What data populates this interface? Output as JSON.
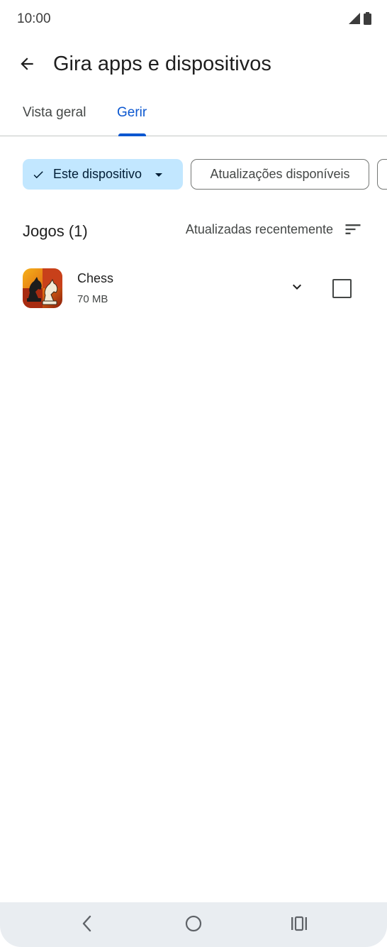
{
  "status_bar": {
    "time": "10:00",
    "icons": [
      "signal-icon",
      "battery-icon"
    ]
  },
  "app_bar": {
    "back_icon": "arrow-left-icon",
    "title": "Gira apps e dispositivos"
  },
  "tabs": [
    {
      "label": "Vista geral",
      "selected": false
    },
    {
      "label": "Gerir",
      "selected": true
    }
  ],
  "filters": {
    "device_chip": {
      "label": "Este dispositivo",
      "selected": true,
      "icons": [
        "check-icon",
        "dropdown-icon"
      ]
    },
    "updates_chip": {
      "label": "Atualizações disponíveis",
      "selected": false
    }
  },
  "section": {
    "title": "Jogos (1)",
    "sort_label": "Atualizadas recentemente",
    "sort_icon": "sort-icon"
  },
  "apps": [
    {
      "name": "Chess",
      "size": "70 MB",
      "icon": "chess-app-icon",
      "checked": false
    }
  ],
  "nav_bar": {
    "buttons": [
      "nav-back-icon",
      "nav-home-icon",
      "nav-recents-icon"
    ]
  },
  "colors": {
    "accent": "#0b57d0",
    "chip_selected_bg": "#c2e7ff",
    "nav_bar_bg": "#e9edf1"
  }
}
